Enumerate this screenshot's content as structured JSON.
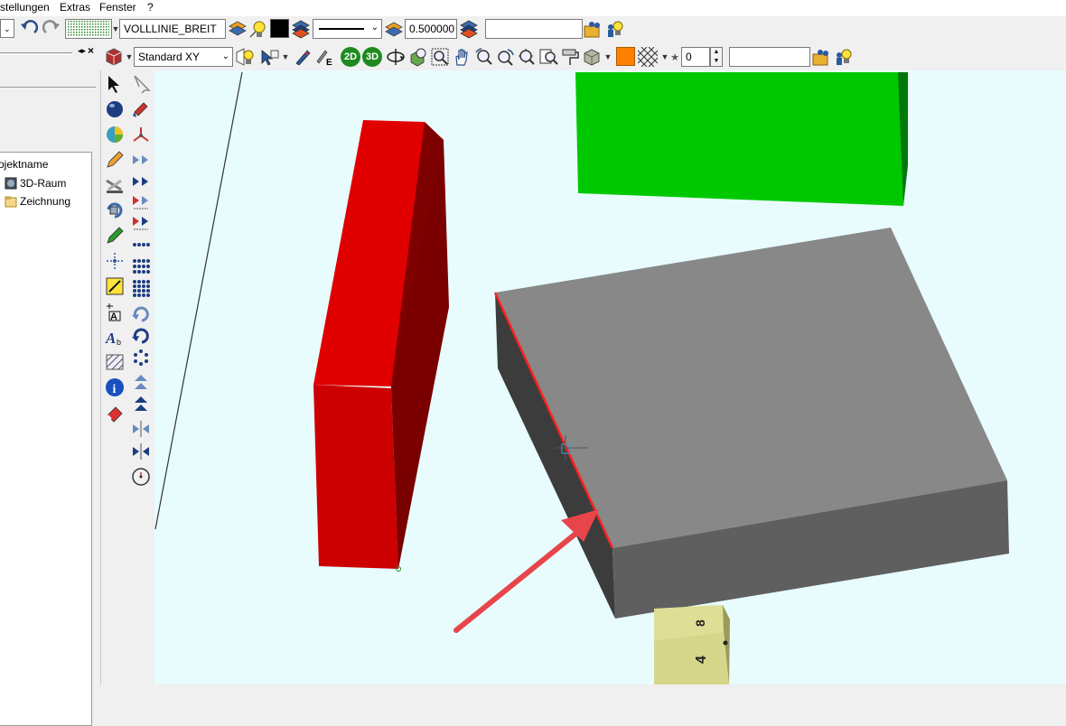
{
  "menu": {
    "items": [
      "stellungen",
      "Extras",
      "Fenster",
      "?"
    ]
  },
  "toolbar1": {
    "linetype_value": "VOLLLINIE_BREIT",
    "line_color": "#000000",
    "linewidth_value": "0.500000",
    "text_field_value": ""
  },
  "toolbar2": {
    "view_value": "Standard XY",
    "mode_2d": "2D",
    "mode_3d": "3D",
    "fill_color": "#ff8000",
    "spinner_value": "0",
    "text_field_value": ""
  },
  "leftpanel": {
    "header": "ojektname",
    "tree": [
      {
        "label": "3D-Raum",
        "icon": "3d-space-icon"
      },
      {
        "label": "Zeichnung",
        "icon": "drawing-folder-icon"
      }
    ]
  },
  "viewport": {
    "background": "#e8fcfe",
    "cube_labels": [
      "8",
      "4"
    ]
  }
}
